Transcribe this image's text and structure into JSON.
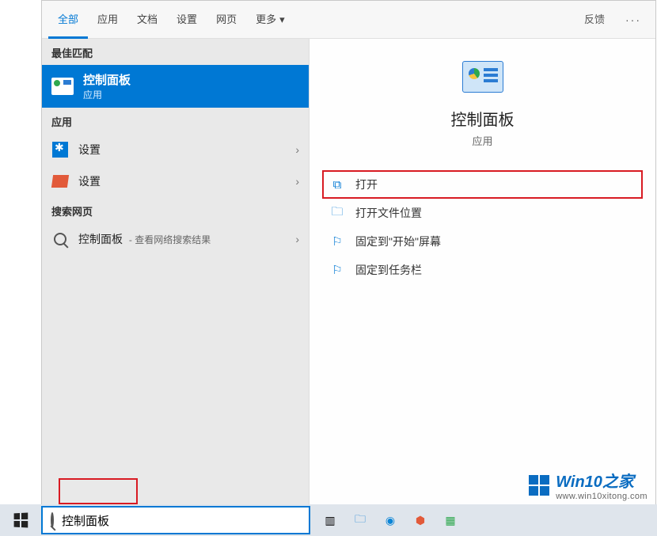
{
  "tabs": {
    "items": [
      "全部",
      "应用",
      "文档",
      "设置",
      "网页",
      "更多"
    ],
    "feedback": "反馈"
  },
  "groups": {
    "best_match": "最佳匹配",
    "apps": "应用",
    "web": "搜索网页"
  },
  "best_match": {
    "title": "控制面板",
    "subtitle": "应用"
  },
  "app_items": [
    {
      "label": "设置"
    },
    {
      "label": "设置"
    }
  ],
  "web_item": {
    "label": "控制面板",
    "hint": "- 查看网络搜索结果"
  },
  "preview": {
    "title": "控制面板",
    "subtitle": "应用"
  },
  "actions": {
    "open": "打开",
    "open_location": "打开文件位置",
    "pin_start": "固定到\"开始\"屏幕",
    "pin_taskbar": "固定到任务栏"
  },
  "search": {
    "value": "控制面板"
  },
  "watermark": {
    "title": "Win10之家",
    "url": "www.win10xitong.com"
  }
}
